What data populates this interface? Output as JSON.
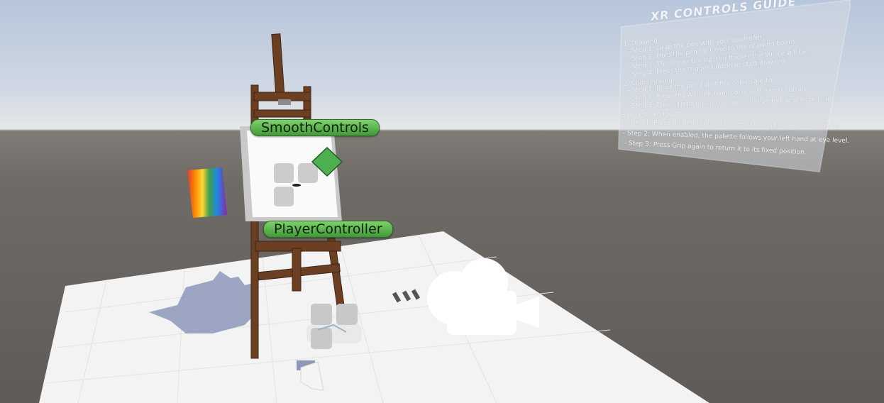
{
  "scene": {
    "colors": {
      "sky": "#b7c6dc",
      "ground": "#6f6b67",
      "floor": "#f0f0f0",
      "wood": "#6b3f22",
      "label_green": "#5fb84b"
    }
  },
  "labels": {
    "smooth_controls": "SmoothControls",
    "player_controller": "PlayerController"
  },
  "guide": {
    "title": "XR CONTROLS GUIDE",
    "lines": [
      "1. Drawing",
      "- Step 1: Grab the pen with your controller.",
      "- Step 2: Hold the pen tip close to the drawing board.",
      "- Step 3: The closer the tip, the thicker the stroke will be.",
      "- Step 4: Press the trigger button to start drawing.",
      "2. Color Picking",
      "- Step 1: Point the pen tip at the color palette.",
      "- Step 2: Press the A (right hand) or X (left hand) button.",
      "- Step 3: The current brush color will change to the selected one.",
      "3. Palette Follow Mode",
      "- Step 1: Press the left hand Grip button to toggle the palette mode.",
      "- Step 2: When enabled, the palette follows your left hand at eye level.",
      "- Step 3: Press Grip again to return it to its fixed position."
    ]
  },
  "icons": {
    "camera": "camera-gizmo-icon",
    "object_gizmo": "object-gizmo-icon",
    "diamond": "diamond-gizmo-icon"
  }
}
